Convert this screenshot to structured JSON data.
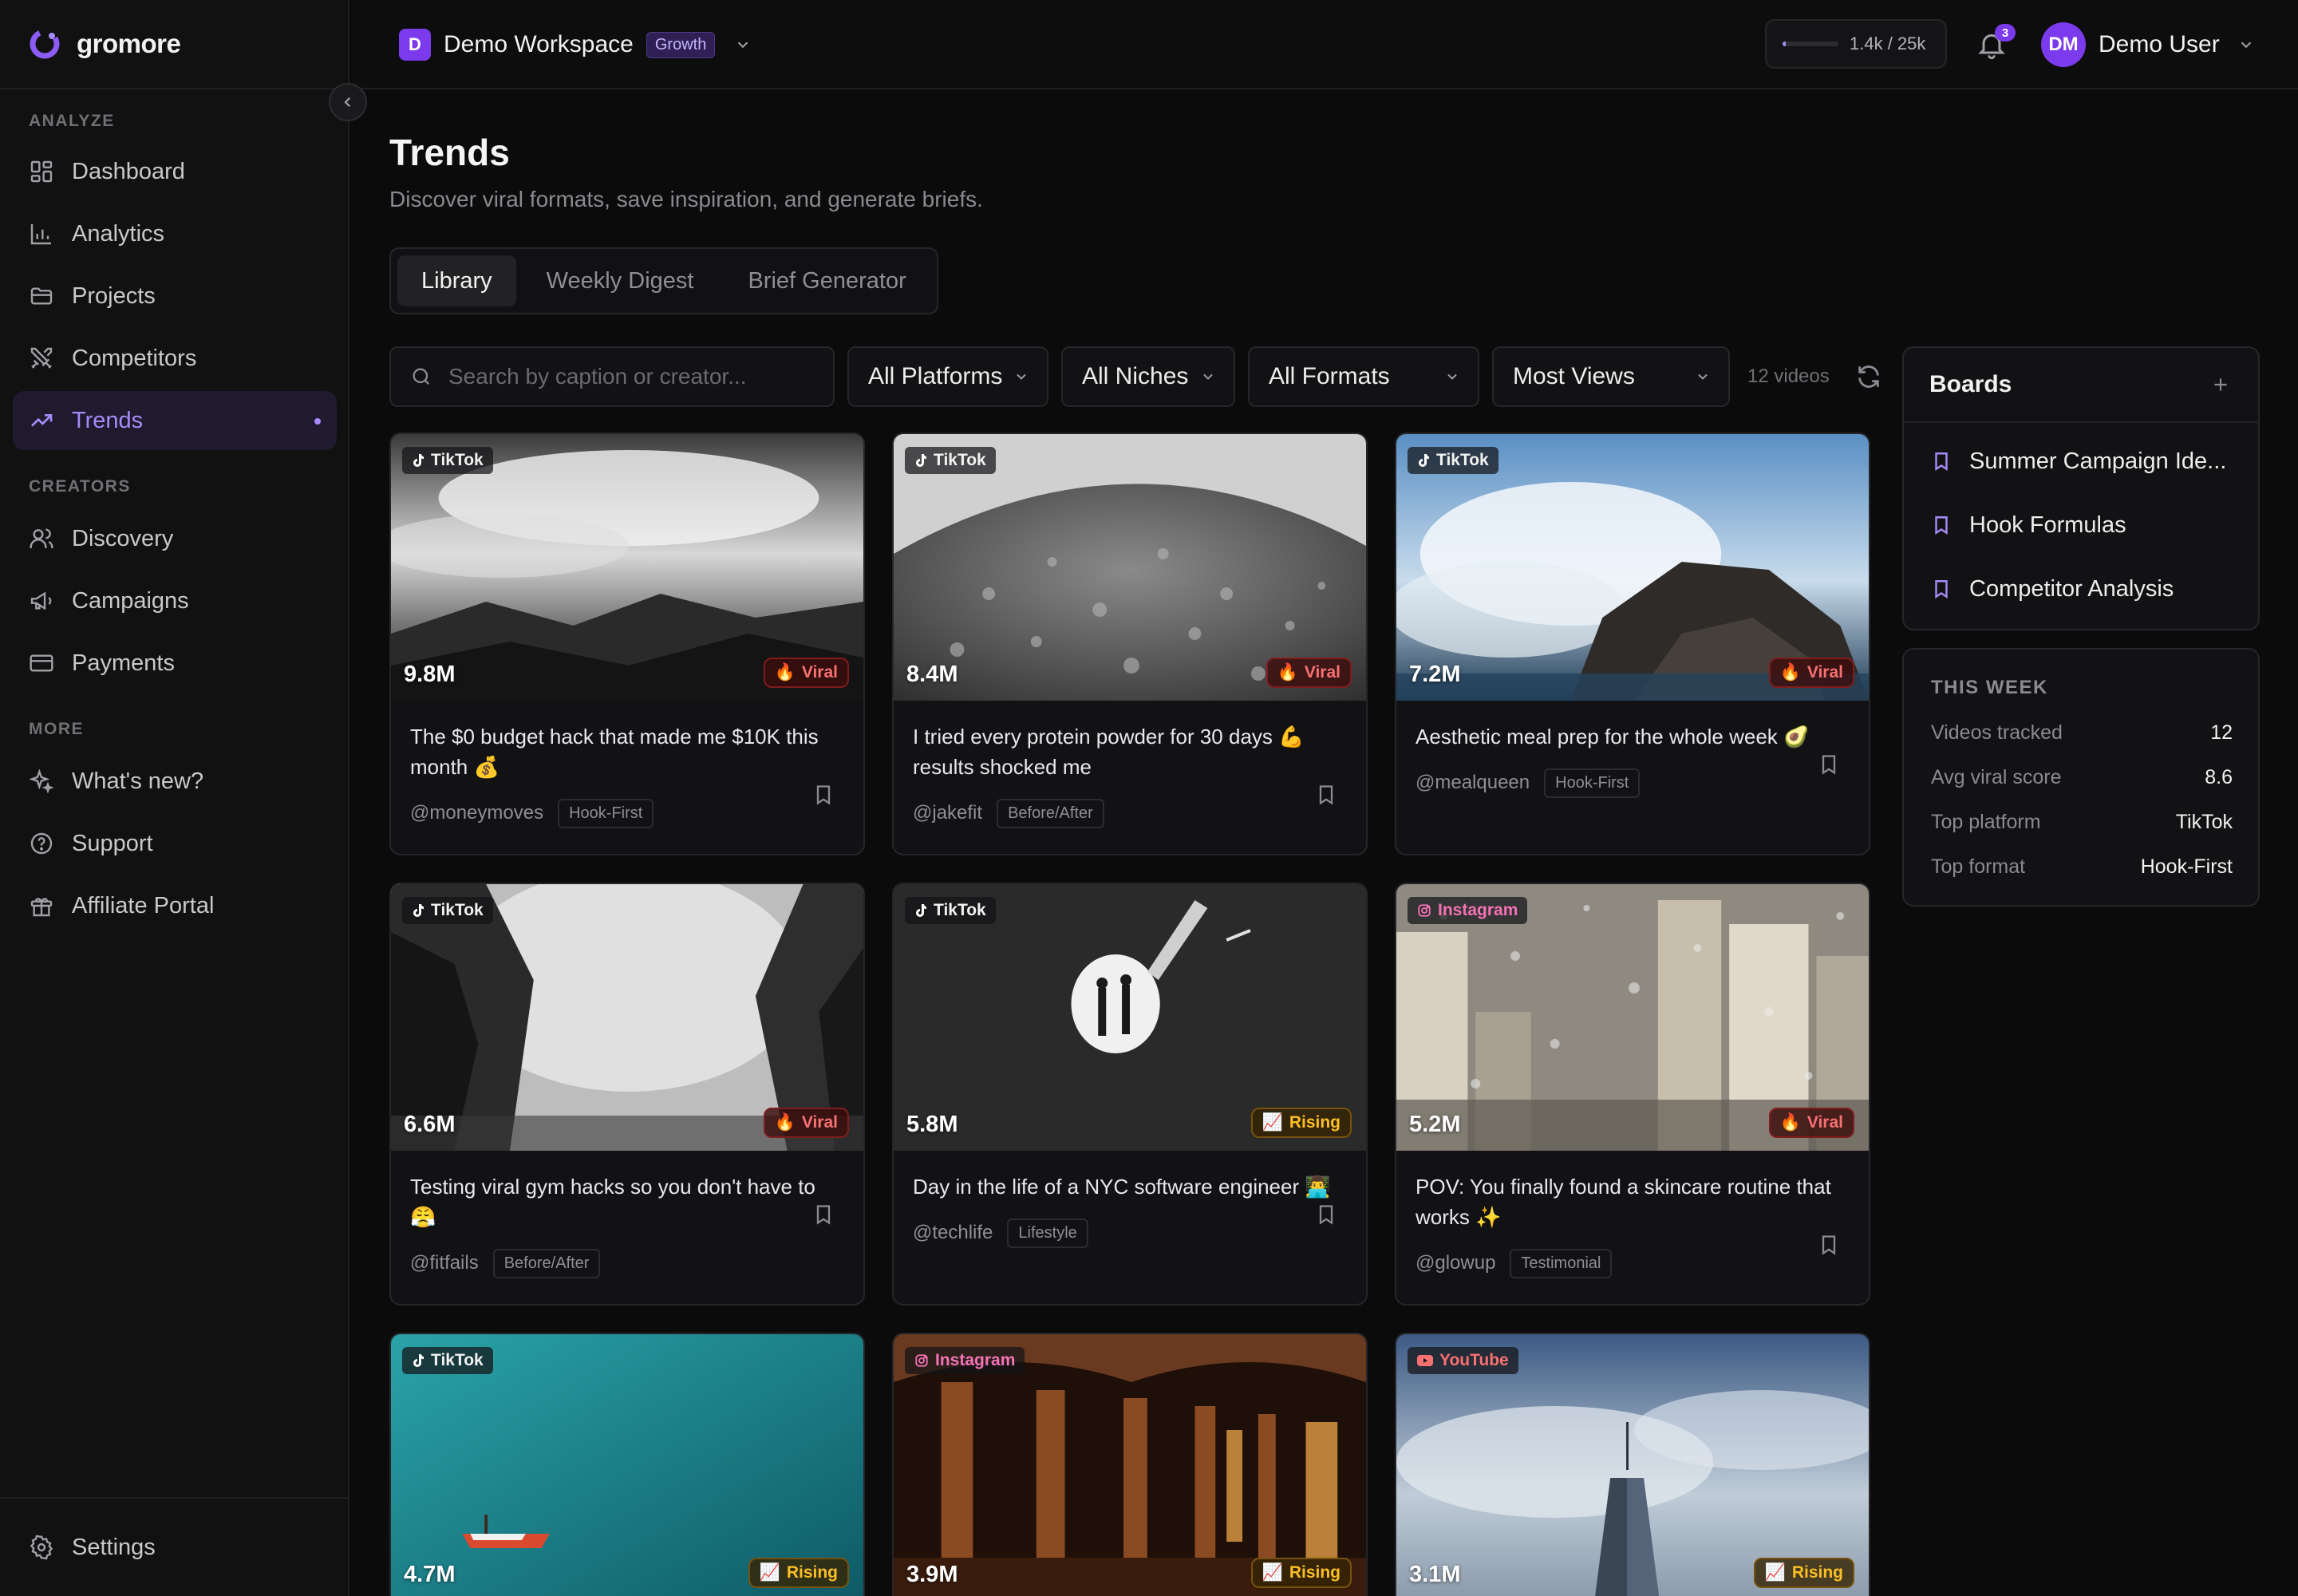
{
  "brand": {
    "name": "gromore"
  },
  "sidebar": {
    "sections": {
      "analyze": "ANALYZE",
      "creators": "CREATORS",
      "more": "MORE"
    },
    "items": [
      {
        "label": "Dashboard",
        "icon": "dashboard-icon"
      },
      {
        "label": "Analytics",
        "icon": "bar-chart-icon"
      },
      {
        "label": "Projects",
        "icon": "folder-icon"
      },
      {
        "label": "Competitors",
        "icon": "swords-icon"
      },
      {
        "label": "Trends",
        "icon": "trending-up-icon",
        "active": true
      },
      {
        "label": "Discovery",
        "icon": "users-icon"
      },
      {
        "label": "Campaigns",
        "icon": "megaphone-icon"
      },
      {
        "label": "Payments",
        "icon": "credit-card-icon"
      },
      {
        "label": "What's new?",
        "icon": "sparkles-icon"
      },
      {
        "label": "Support",
        "icon": "help-circle-icon"
      },
      {
        "label": "Affiliate Portal",
        "icon": "gift-icon"
      }
    ],
    "settings": "Settings"
  },
  "topbar": {
    "workspace_initial": "D",
    "workspace_name": "Demo Workspace",
    "plan_badge": "Growth",
    "usage_text": "1.4k / 25k",
    "usage_fraction": 0.056,
    "notifications_count": "3",
    "user_initials": "DM",
    "user_name": "Demo User"
  },
  "page": {
    "title": "Trends",
    "subtitle": "Discover viral formats, save inspiration, and generate briefs."
  },
  "tabs": [
    {
      "label": "Library",
      "active": true
    },
    {
      "label": "Weekly Digest"
    },
    {
      "label": "Brief Generator"
    }
  ],
  "filters": {
    "search_placeholder": "Search by caption or creator...",
    "platform": "All Platforms",
    "niche": "All Niches",
    "format": "All Formats",
    "sort": "Most Views",
    "count": "12 videos"
  },
  "videos": [
    {
      "platform": "TikTok",
      "views": "9.8M",
      "status": "Viral",
      "caption": "The $0 budget hack that made me $10K this month 💰",
      "creator": "@moneymoves",
      "format": "Hook-First"
    },
    {
      "platform": "TikTok",
      "views": "8.4M",
      "status": "Viral",
      "caption": "I tried every protein powder for 30 days 💪 results shocked me",
      "creator": "@jakefit",
      "format": "Before/After"
    },
    {
      "platform": "TikTok",
      "views": "7.2M",
      "status": "Viral",
      "caption": "Aesthetic meal prep for the whole week 🥑",
      "creator": "@mealqueen",
      "format": "Hook-First"
    },
    {
      "platform": "TikTok",
      "views": "6.6M",
      "status": "Viral",
      "caption": "Testing viral gym hacks so you don't have to 😤",
      "creator": "@fitfails",
      "format": "Before/After"
    },
    {
      "platform": "TikTok",
      "views": "5.8M",
      "status": "Rising",
      "caption": "Day in the life of a NYC software engineer 👨‍💻",
      "creator": "@techlife",
      "format": "Lifestyle"
    },
    {
      "platform": "Instagram",
      "views": "5.2M",
      "status": "Viral",
      "caption": "POV: You finally found a skincare routine that works ✨",
      "creator": "@glowup",
      "format": "Testimonial"
    },
    {
      "platform": "TikTok",
      "views": "4.7M",
      "status": "Rising"
    },
    {
      "platform": "Instagram",
      "views": "3.9M",
      "status": "Rising"
    },
    {
      "platform": "YouTube",
      "views": "3.1M",
      "status": "Rising"
    }
  ],
  "boards": {
    "title": "Boards",
    "items": [
      "Summer Campaign Ide...",
      "Hook Formulas",
      "Competitor Analysis"
    ]
  },
  "this_week": {
    "title": "THIS WEEK",
    "rows": [
      {
        "label": "Videos tracked",
        "value": "12"
      },
      {
        "label": "Avg viral score",
        "value": "8.6"
      },
      {
        "label": "Top platform",
        "value": "TikTok"
      },
      {
        "label": "Top format",
        "value": "Hook-First"
      }
    ]
  },
  "colors": {
    "accent": "#a78bfa",
    "brand": "#7c3aed",
    "viral": "#f87171",
    "rising": "#fbbf24"
  }
}
